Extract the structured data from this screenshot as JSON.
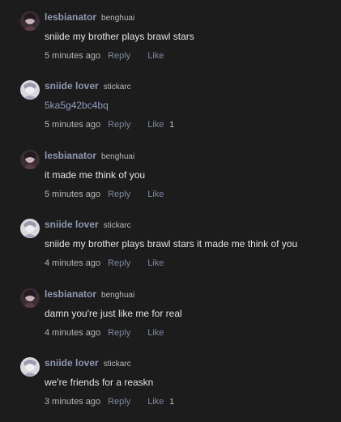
{
  "comments": [
    {
      "display_name": "lesbianator",
      "username": "benghuai",
      "avatar": "lesbianator-avatar",
      "text": "sniide my brother plays brawl stars",
      "is_link": false,
      "timestamp": "5 minutes ago",
      "reply_label": "Reply",
      "like_label": "Like",
      "like_count": ""
    },
    {
      "display_name": "sniide lover",
      "username": "stickarc",
      "avatar": "sniide-lover-avatar",
      "text": "5ka5g42bc4bq",
      "is_link": true,
      "timestamp": "5 minutes ago",
      "reply_label": "Reply",
      "like_label": "Like",
      "like_count": "1"
    },
    {
      "display_name": "lesbianator",
      "username": "benghuai",
      "avatar": "lesbianator-avatar",
      "text": "it made me think of you",
      "is_link": false,
      "timestamp": "5 minutes ago",
      "reply_label": "Reply",
      "like_label": "Like",
      "like_count": ""
    },
    {
      "display_name": "sniide lover",
      "username": "stickarc",
      "avatar": "sniide-lover-avatar",
      "text": "sniide my brother plays brawl stars it made me think of you",
      "is_link": false,
      "timestamp": "4 minutes ago",
      "reply_label": "Reply",
      "like_label": "Like",
      "like_count": ""
    },
    {
      "display_name": "lesbianator",
      "username": "benghuai",
      "avatar": "lesbianator-avatar",
      "text": "damn you're just like me for real",
      "is_link": false,
      "timestamp": "4 minutes ago",
      "reply_label": "Reply",
      "like_label": "Like",
      "like_count": ""
    },
    {
      "display_name": "sniide lover",
      "username": "stickarc",
      "avatar": "sniide-lover-avatar",
      "text": "we're friends for a reaskn",
      "is_link": false,
      "timestamp": "3 minutes ago",
      "reply_label": "Reply",
      "like_label": "Like",
      "like_count": "1"
    }
  ],
  "colors": {
    "background": "#1c1c1c",
    "name": "#8e97b0",
    "action": "#7d87a3",
    "link": "#8f9ab8"
  }
}
